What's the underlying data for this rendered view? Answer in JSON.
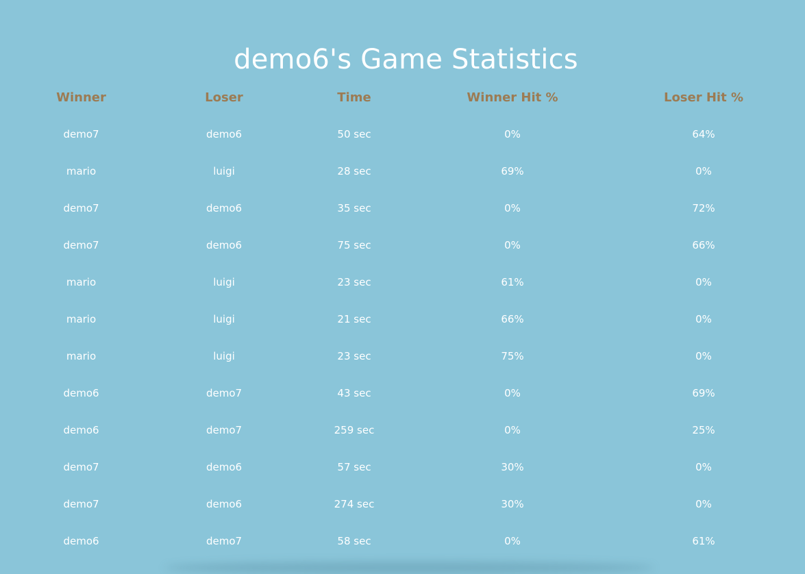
{
  "page": {
    "title": "demo6's Game Statistics"
  },
  "table": {
    "headers": [
      "Winner",
      "Loser",
      "Time",
      "Winner Hit %",
      "Loser Hit %"
    ],
    "rows": [
      [
        "demo7",
        "demo6",
        "50 sec",
        "0%",
        "64%"
      ],
      [
        "mario",
        "luigi",
        "28 sec",
        "69%",
        "0%"
      ],
      [
        "demo7",
        "demo6",
        "35 sec",
        "0%",
        "72%"
      ],
      [
        "demo7",
        "demo6",
        "75 sec",
        "0%",
        "66%"
      ],
      [
        "mario",
        "luigi",
        "23 sec",
        "61%",
        "0%"
      ],
      [
        "mario",
        "luigi",
        "21 sec",
        "66%",
        "0%"
      ],
      [
        "mario",
        "luigi",
        "23 sec",
        "75%",
        "0%"
      ],
      [
        "demo6",
        "demo7",
        "43 sec",
        "0%",
        "69%"
      ],
      [
        "demo6",
        "demo7",
        "259 sec",
        "0%",
        "25%"
      ],
      [
        "demo7",
        "demo6",
        "57 sec",
        "30%",
        "0%"
      ],
      [
        "demo7",
        "demo6",
        "274 sec",
        "30%",
        "0%"
      ],
      [
        "demo6",
        "demo7",
        "58 sec",
        "0%",
        "61%"
      ]
    ]
  },
  "colors": {
    "background": "#8ac5d9",
    "header_text": "#9c7b53",
    "body_text": "#ffffff"
  }
}
